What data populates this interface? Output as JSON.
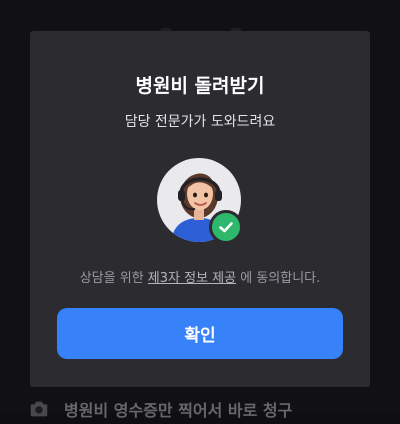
{
  "background": {
    "bottom_row_text": "병원비 영수증만 찍어서 바로 청구",
    "bottom_row_icon": "camera-icon"
  },
  "modal": {
    "title": "병원비 돌려받기",
    "subtitle": "담당 전문가가 도와드려요",
    "avatar_icon": "agent-avatar-with-headset",
    "badge_icon": "check-icon",
    "consent_before": "상담을 위한 ",
    "consent_link": "제3자 정보 제공",
    "consent_after": " 에 동의합니다.",
    "confirm_label": "확인"
  },
  "colors": {
    "accent": "#3782f8",
    "sheet": "#2b2b30",
    "badge": "#2eb86b",
    "backdrop": "#111113"
  }
}
